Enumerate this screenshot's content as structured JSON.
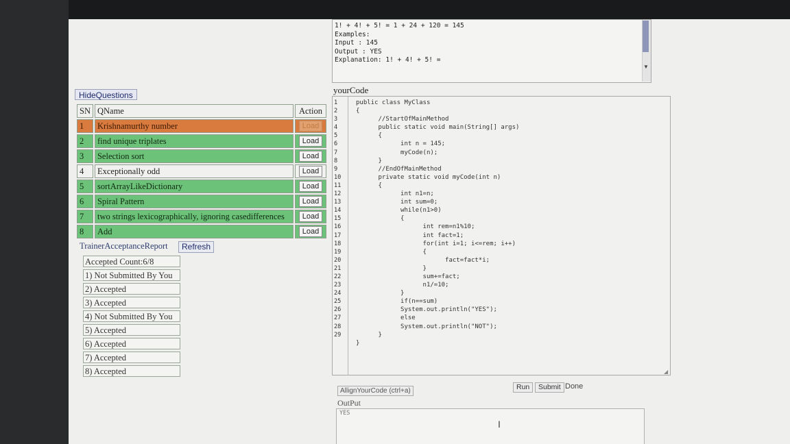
{
  "problem": {
    "lines": [
      "1! + 4! + 5! = 1 + 24 + 120 = 145",
      "",
      "Examples:",
      "",
      "Input : 145",
      "Output : YES",
      "Explanation: 1! + 4! + 5! ="
    ]
  },
  "left": {
    "hide_questions_label": "HideQuestions",
    "table_headers": {
      "sn": "SN",
      "qname": "QName",
      "action": "Action"
    },
    "questions": [
      {
        "sn": "1",
        "name": "Krishnamurthy number",
        "action": "Load"
      },
      {
        "sn": "2",
        "name": "find unique triplates",
        "action": "Load"
      },
      {
        "sn": "3",
        "name": "Selection sort",
        "action": "Load"
      },
      {
        "sn": "4",
        "name": "Exceptionally odd",
        "action": "Load"
      },
      {
        "sn": "5",
        "name": "sortArrayLikeDictionary",
        "action": "Load"
      },
      {
        "sn": "6",
        "name": "Spiral Pattern",
        "action": "Load"
      },
      {
        "sn": "7",
        "name": "two strings lexicographically, ignoring casedifferences",
        "action": "Load"
      },
      {
        "sn": "8",
        "name": "Add",
        "action": "Load"
      }
    ],
    "report_label": "TrainerAcceptanceReport",
    "refresh_label": "Refresh",
    "accepted_count": "Accepted Count:6/8",
    "statuses": [
      "1) Not Submitted By You",
      "2) Accepted",
      "3) Accepted",
      "4) Not Submitted By You",
      "5) Accepted",
      "6) Accepted",
      "7) Accepted",
      "8) Accepted"
    ]
  },
  "editor": {
    "label": "yourCode",
    "line_numbers": [
      "1",
      "2",
      "3",
      "4",
      "5",
      "6",
      "7",
      "8",
      "9",
      "10",
      "11",
      "12",
      "13",
      "14",
      "15",
      "16",
      "17",
      "18",
      "19",
      "20",
      "21",
      "22",
      "23",
      "24",
      "25",
      "26",
      "27",
      "28",
      "29"
    ],
    "code_lines": [
      "public class MyClass",
      "{",
      "      //StartOfMainMethod",
      "      public static void main(String[] args)",
      "      {",
      "            int n = 145;",
      "            myCode(n);",
      "      }",
      "      //EndOfMainMethod",
      "      private static void myCode(int n)",
      "      {",
      "            int n1=n;",
      "            int sum=0;",
      "            while(n1>0)",
      "            {",
      "                  int rem=n1%10;",
      "                  int fact=1;",
      "                  for(int i=1; i<=rem; i++)",
      "                  {",
      "                        fact=fact*i;",
      "                  }",
      "                  sum+=fact;",
      "                  n1/=10;",
      "            }",
      "            if(n==sum)",
      "            System.out.println(\"YES\");",
      "            else",
      "            System.out.println(\"NOT\");",
      "      }",
      "}"
    ]
  },
  "bottom": {
    "allign_label": "AllignYourCode (ctrl+a)",
    "run_label": "Run",
    "submit_label": "Submit",
    "done_label": "Done",
    "output_label": "OutPut",
    "output_value": "YES"
  }
}
